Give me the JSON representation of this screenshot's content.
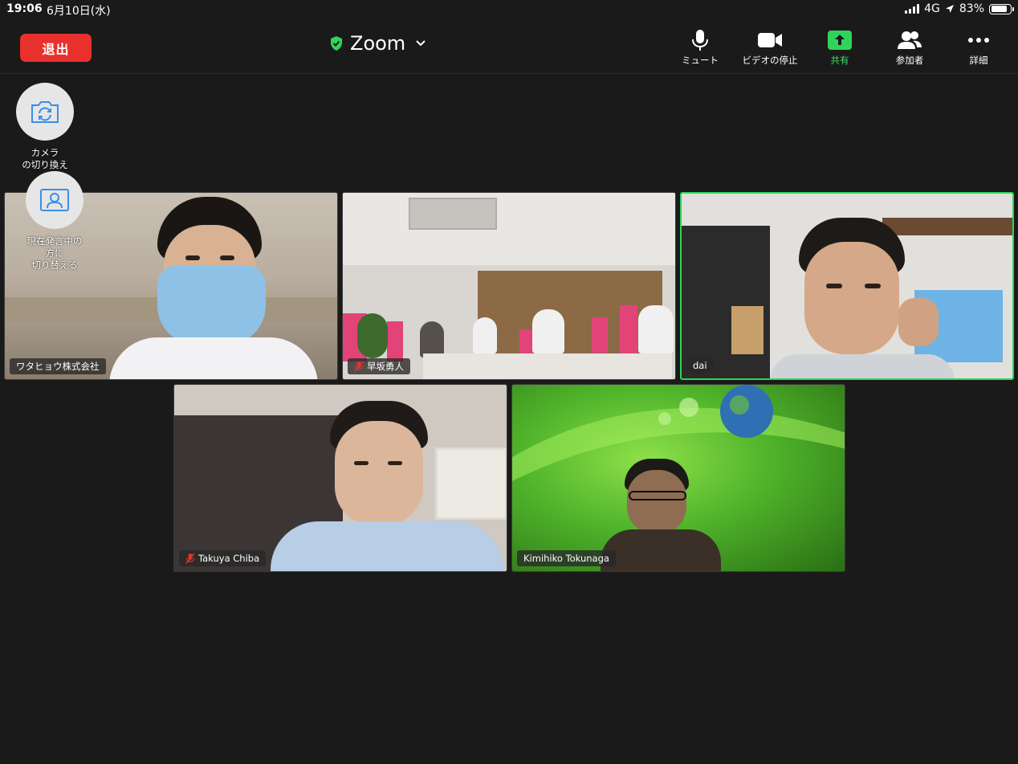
{
  "status_bar": {
    "time": "19:06",
    "date": "6月10日(水)",
    "network": "4G",
    "battery": "83%",
    "battery_level": 0.83
  },
  "toolbar": {
    "leave_label": "退出",
    "title": "Zoom",
    "title_icon": "shield-check-icon",
    "buttons": [
      {
        "label": "ミュート",
        "icon": "microphone-icon"
      },
      {
        "label": "ビデオの停止",
        "icon": "video-camera-icon"
      },
      {
        "label": "共有",
        "icon": "share-arrow-icon"
      },
      {
        "label": "参加者",
        "icon": "participants-icon"
      },
      {
        "label": "詳細",
        "icon": "more-icon"
      }
    ]
  },
  "side_buttons": {
    "switch_camera": {
      "label": "カメラ\nの切り換え",
      "icon": "camera-switch-icon"
    },
    "active_speaker": {
      "label": "現在発言中の\n方に\n切り替える",
      "icon": "speaker-view-icon"
    }
  },
  "participants": [
    {
      "name": "ワタヒョウ株式会社",
      "muted": false,
      "active": false
    },
    {
      "name": "早坂勇人",
      "muted": true,
      "active": false
    },
    {
      "name": "dai",
      "muted": false,
      "active": true
    },
    {
      "name": "Takuya Chiba",
      "muted": true,
      "active": false
    },
    {
      "name": "Kimihiko Tokunaga",
      "muted": false,
      "active": false
    }
  ],
  "colors": {
    "leave": "#e8312c",
    "share": "#3ddc68",
    "active_border": "#2fd45a",
    "background": "#1a1a1a"
  }
}
